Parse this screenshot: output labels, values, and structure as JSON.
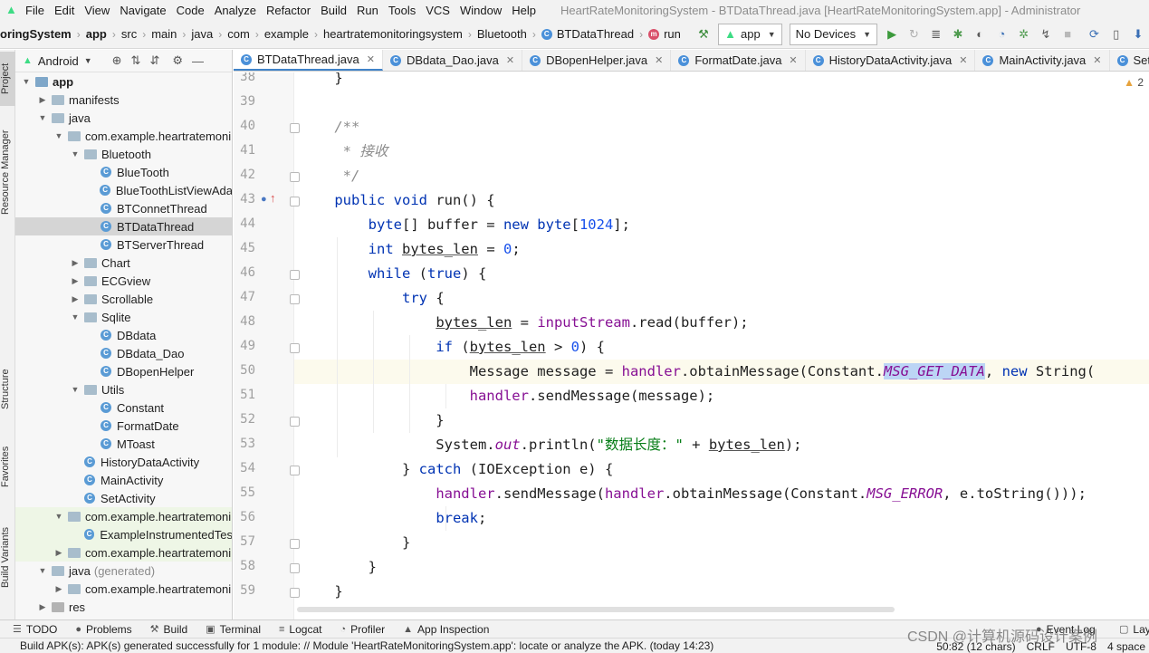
{
  "menu": {
    "items": [
      "File",
      "Edit",
      "View",
      "Navigate",
      "Code",
      "Analyze",
      "Refactor",
      "Build",
      "Run",
      "Tools",
      "VCS",
      "Window",
      "Help"
    ],
    "window_title": "HeartRateMonitoringSystem - BTDataThread.java [HeartRateMonitoringSystem.app] - Administrator"
  },
  "nav": {
    "crumbs": [
      "oringSystem",
      "app",
      "src",
      "main",
      "java",
      "com",
      "example",
      "heartratemonitoringsystem",
      "Bluetooth",
      "BTDataThread",
      "run"
    ],
    "run_config": "app",
    "device": "No Devices"
  },
  "left_tabs": [
    "Project",
    "Resource Manager",
    "Structure",
    "Favorites",
    "Build Variants"
  ],
  "project": {
    "view_mode": "Android",
    "tree": [
      {
        "label": "app",
        "depth": 0,
        "arrow": "down",
        "icon": "app",
        "bold": true
      },
      {
        "label": "manifests",
        "depth": 1,
        "arrow": "right",
        "icon": "folder"
      },
      {
        "label": "java",
        "depth": 1,
        "arrow": "down",
        "icon": "folder"
      },
      {
        "label": "com.example.heartratemoni",
        "depth": 2,
        "arrow": "down",
        "icon": "package"
      },
      {
        "label": "Bluetooth",
        "depth": 3,
        "arrow": "down",
        "icon": "package"
      },
      {
        "label": "BlueTooth",
        "depth": 4,
        "arrow": "none",
        "icon": "class"
      },
      {
        "label": "BlueToothListViewAda",
        "depth": 4,
        "arrow": "none",
        "icon": "class"
      },
      {
        "label": "BTConnetThread",
        "depth": 4,
        "arrow": "none",
        "icon": "class"
      },
      {
        "label": "BTDataThread",
        "depth": 4,
        "arrow": "none",
        "icon": "class",
        "selected": true
      },
      {
        "label": "BTServerThread",
        "depth": 4,
        "arrow": "none",
        "icon": "class"
      },
      {
        "label": "Chart",
        "depth": 3,
        "arrow": "right",
        "icon": "package"
      },
      {
        "label": "ECGview",
        "depth": 3,
        "arrow": "right",
        "icon": "package"
      },
      {
        "label": "Scrollable",
        "depth": 3,
        "arrow": "right",
        "icon": "package"
      },
      {
        "label": "Sqlite",
        "depth": 3,
        "arrow": "down",
        "icon": "package"
      },
      {
        "label": "DBdata",
        "depth": 4,
        "arrow": "none",
        "icon": "class"
      },
      {
        "label": "DBdata_Dao",
        "depth": 4,
        "arrow": "none",
        "icon": "class"
      },
      {
        "label": "DBopenHelper",
        "depth": 4,
        "arrow": "none",
        "icon": "class"
      },
      {
        "label": "Utils",
        "depth": 3,
        "arrow": "down",
        "icon": "package"
      },
      {
        "label": "Constant",
        "depth": 4,
        "arrow": "none",
        "icon": "class"
      },
      {
        "label": "FormatDate",
        "depth": 4,
        "arrow": "none",
        "icon": "class"
      },
      {
        "label": "MToast",
        "depth": 4,
        "arrow": "none",
        "icon": "class"
      },
      {
        "label": "HistoryDataActivity",
        "depth": 3,
        "arrow": "none",
        "icon": "class"
      },
      {
        "label": "MainActivity",
        "depth": 3,
        "arrow": "none",
        "icon": "class"
      },
      {
        "label": "SetActivity",
        "depth": 3,
        "arrow": "none",
        "icon": "class"
      },
      {
        "label": "com.example.heartratemoni",
        "depth": 2,
        "arrow": "down",
        "icon": "package",
        "test": true
      },
      {
        "label": "ExampleInstrumentedTes",
        "depth": 3,
        "arrow": "none",
        "icon": "class",
        "test": true
      },
      {
        "label": "com.example.heartratemoni",
        "depth": 2,
        "arrow": "right",
        "icon": "package",
        "test": true
      },
      {
        "label": "java",
        "depth": 1,
        "arrow": "down",
        "icon": "folder",
        "suffix": "(generated)"
      },
      {
        "label": "com.example.heartratemoni",
        "depth": 2,
        "arrow": "right",
        "icon": "package"
      },
      {
        "label": "res",
        "depth": 1,
        "arrow": "right",
        "icon": "res"
      }
    ]
  },
  "tabs": [
    "BTDataThread.java",
    "DBdata_Dao.java",
    "DBopenHelper.java",
    "FormatDate.java",
    "HistoryDataActivity.java",
    "MainActivity.java",
    "SetActivi"
  ],
  "editor": {
    "warnings": "2",
    "line_numbers": [
      "38",
      "39",
      "40",
      "41",
      "42",
      "43",
      "44",
      "45",
      "46",
      "47",
      "48",
      "49",
      "50",
      "51",
      "52",
      "53",
      "54",
      "55",
      "56",
      "57",
      "58",
      "59"
    ],
    "current_line": "50",
    "lines": [
      [
        {
          "t": "    }",
          "c": ""
        }
      ],
      [
        {
          "t": "",
          "c": ""
        }
      ],
      [
        {
          "t": "    /**",
          "c": "cm"
        }
      ],
      [
        {
          "t": "     * 接收",
          "c": "cm"
        }
      ],
      [
        {
          "t": "     */",
          "c": "cm"
        }
      ],
      [
        {
          "t": "    ",
          "c": ""
        },
        {
          "t": "public void ",
          "c": "kw"
        },
        {
          "t": "run() {",
          "c": ""
        }
      ],
      [
        {
          "t": "        ",
          "c": ""
        },
        {
          "t": "byte",
          "c": "kw"
        },
        {
          "t": "[] buffer = ",
          "c": ""
        },
        {
          "t": "new byte",
          "c": "kw"
        },
        {
          "t": "[",
          "c": ""
        },
        {
          "t": "1024",
          "c": "num"
        },
        {
          "t": "];",
          "c": ""
        }
      ],
      [
        {
          "t": "        ",
          "c": ""
        },
        {
          "t": "int ",
          "c": "kw"
        },
        {
          "t": "bytes_len",
          "c": "ul"
        },
        {
          "t": " = ",
          "c": ""
        },
        {
          "t": "0",
          "c": "num"
        },
        {
          "t": ";",
          "c": ""
        }
      ],
      [
        {
          "t": "        ",
          "c": ""
        },
        {
          "t": "while ",
          "c": "kw"
        },
        {
          "t": "(",
          "c": ""
        },
        {
          "t": "true",
          "c": "kw"
        },
        {
          "t": ") {",
          "c": ""
        }
      ],
      [
        {
          "t": "            ",
          "c": ""
        },
        {
          "t": "try ",
          "c": "kw"
        },
        {
          "t": "{",
          "c": ""
        }
      ],
      [
        {
          "t": "                ",
          "c": ""
        },
        {
          "t": "bytes_len",
          "c": "ul"
        },
        {
          "t": " = ",
          "c": ""
        },
        {
          "t": "inputStream",
          "c": "fld"
        },
        {
          "t": ".read(buffer);",
          "c": ""
        }
      ],
      [
        {
          "t": "                ",
          "c": ""
        },
        {
          "t": "if ",
          "c": "kw"
        },
        {
          "t": "(",
          "c": ""
        },
        {
          "t": "bytes_len",
          "c": "ul"
        },
        {
          "t": " > ",
          "c": ""
        },
        {
          "t": "0",
          "c": "num"
        },
        {
          "t": ") {",
          "c": ""
        }
      ],
      [
        {
          "t": "                    Message message = ",
          "c": ""
        },
        {
          "t": "handler",
          "c": "fld"
        },
        {
          "t": ".obtainMessage(Constant.",
          "c": ""
        },
        {
          "t": "MSG_GET_DATA",
          "c": "sfld hl"
        },
        {
          "t": ", ",
          "c": ""
        },
        {
          "t": "new ",
          "c": "kw"
        },
        {
          "t": "String(",
          "c": ""
        }
      ],
      [
        {
          "t": "                    ",
          "c": ""
        },
        {
          "t": "handler",
          "c": "fld"
        },
        {
          "t": ".sendMessage(message);",
          "c": ""
        }
      ],
      [
        {
          "t": "                }",
          "c": ""
        }
      ],
      [
        {
          "t": "                System.",
          "c": ""
        },
        {
          "t": "out",
          "c": "sfld"
        },
        {
          "t": ".println(",
          "c": ""
        },
        {
          "t": "\"数据长度：\"",
          "c": "str"
        },
        {
          "t": " + ",
          "c": ""
        },
        {
          "t": "bytes_len",
          "c": "ul"
        },
        {
          "t": ");",
          "c": ""
        }
      ],
      [
        {
          "t": "            } ",
          "c": ""
        },
        {
          "t": "catch ",
          "c": "kw"
        },
        {
          "t": "(IOException e) {",
          "c": ""
        }
      ],
      [
        {
          "t": "                ",
          "c": ""
        },
        {
          "t": "handler",
          "c": "fld"
        },
        {
          "t": ".sendMessage(",
          "c": ""
        },
        {
          "t": "handler",
          "c": "fld"
        },
        {
          "t": ".obtainMessage(Constant.",
          "c": ""
        },
        {
          "t": "MSG_ERROR",
          "c": "sfld"
        },
        {
          "t": ", e.toString()));",
          "c": ""
        }
      ],
      [
        {
          "t": "                ",
          "c": ""
        },
        {
          "t": "break",
          "c": "kw"
        },
        {
          "t": ";",
          "c": ""
        }
      ],
      [
        {
          "t": "            }",
          "c": ""
        }
      ],
      [
        {
          "t": "        }",
          "c": ""
        }
      ],
      [
        {
          "t": "    }",
          "c": ""
        }
      ]
    ]
  },
  "bottom_tools": [
    "TODO",
    "Problems",
    "Build",
    "Terminal",
    "Logcat",
    "Profiler",
    "App Inspection",
    "Event Log",
    "Layou"
  ],
  "status": {
    "message": "Build APK(s): APK(s) generated successfully for 1 module: // Module 'HeartRateMonitoringSystem.app': locate or analyze the APK. (today 14:23)",
    "position": "50:82 (12 chars)",
    "line_sep": "CRLF",
    "encoding": "UTF-8",
    "indent": "4 space"
  },
  "watermark": "CSDN @计算机源码设计案例",
  "colors": {
    "keyword": "#0033b3",
    "comment": "#8c8c8c",
    "number": "#1750eb",
    "field": "#871094",
    "string": "#067d17",
    "selection": "#bcd5f5",
    "accent": "#4083c9"
  }
}
